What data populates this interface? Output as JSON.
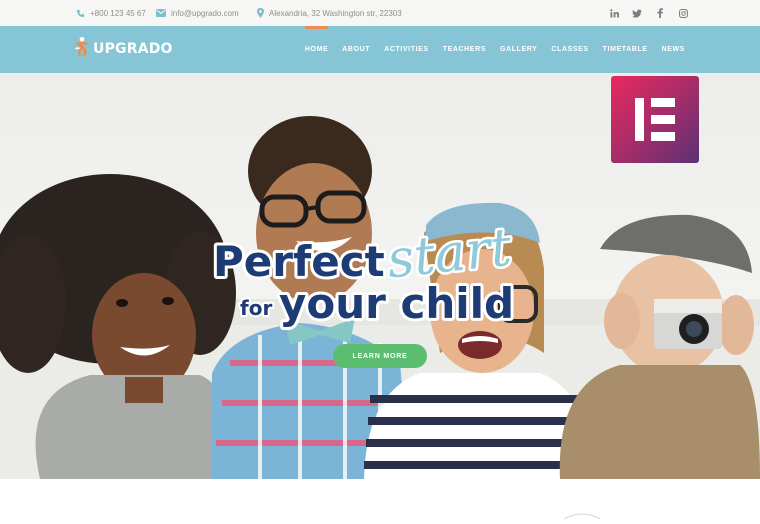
{
  "topbar": {
    "phone": "+800 123 45 67",
    "email": "info@upgrado.com",
    "address": "Alexandria, 32 Washington str, 22303",
    "social_icons": [
      "linkedin-icon",
      "twitter-icon",
      "facebook-icon",
      "instagram-icon"
    ]
  },
  "brand": {
    "name": "UPGRADO"
  },
  "nav": {
    "items": [
      {
        "label": "HOME",
        "active": true
      },
      {
        "label": "ABOUT"
      },
      {
        "label": "ACTIVITIES"
      },
      {
        "label": "TEACHERS"
      },
      {
        "label": "GALLERY"
      },
      {
        "label": "CLASSES"
      },
      {
        "label": "TIMETABLE"
      },
      {
        "label": "NEWS"
      }
    ]
  },
  "hero": {
    "line1": "Perfect",
    "script_word": "start",
    "line2_small": "for",
    "line2": "your child",
    "cta": "LEARN MORE"
  },
  "colors": {
    "nav_bg": "#86c5d6",
    "headline": "#1d3b74",
    "script": "#8fcad8",
    "cta": "#5cbd70",
    "active_indicator": "#f08c4f"
  }
}
